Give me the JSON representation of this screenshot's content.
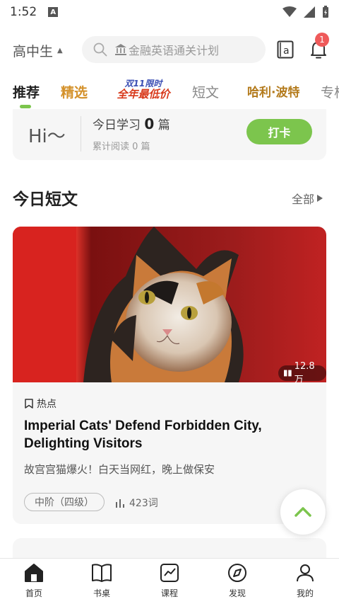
{
  "status_bar": {
    "time": "1:52",
    "a_label": "A"
  },
  "header": {
    "grade": "高中生",
    "search_placeholder": "金融英语通关计划",
    "dict_label": "a",
    "notification_count": "1"
  },
  "tabs": [
    {
      "label": "推荐"
    },
    {
      "label": "精选"
    },
    {
      "label": "短文"
    },
    {
      "label": "专栏"
    }
  ],
  "promo_tabs": {
    "promo1_line1": "双11限时",
    "promo1_line2": "全年最低价",
    "promo2": "哈利·波特"
  },
  "checkin": {
    "greeting": "Hi～",
    "today_prefix": "今日学习",
    "today_count": "0",
    "today_unit": "篇",
    "total_text": "累计阅读 0 篇",
    "button": "打卡"
  },
  "section": {
    "title": "今日短文",
    "all_link": "全部"
  },
  "article": {
    "views": "12.8万",
    "category": "热点",
    "title": "Imperial Cats' Defend Forbidden City, Delighting Visitors",
    "subtitle": "故宫宫猫爆火！白天当网红，晚上做保安",
    "level": "中阶（四级）",
    "words": "423词"
  },
  "colors": {
    "accent": "#7cc54d",
    "badge": "#ef5a5a"
  },
  "bottom_nav": [
    {
      "label": "首页",
      "icon": "home-icon"
    },
    {
      "label": "书桌",
      "icon": "book-icon"
    },
    {
      "label": "课程",
      "icon": "chart-icon"
    },
    {
      "label": "发现",
      "icon": "compass-icon"
    },
    {
      "label": "我的",
      "icon": "profile-icon"
    }
  ]
}
